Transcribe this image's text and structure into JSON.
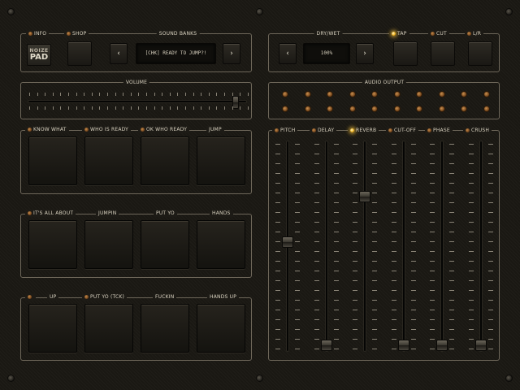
{
  "top": {
    "info_label": "INFO",
    "shop_label": "SHOP",
    "sound_banks_label": "SOUND BANKS",
    "logo_line1": "NOIZE",
    "logo_line2": "PAD",
    "prev_symbol": "‹",
    "next_symbol": "›",
    "bank_display": "[CHK] READY TO JUMP?!",
    "dry_wet_label": "DRY/WET",
    "dry_wet_value": "100%",
    "tap_label": "TAP",
    "cut_label": "CUT",
    "lr_label": "L/R"
  },
  "volume": {
    "label": "VOLUME",
    "level": 0.96
  },
  "audio_output": {
    "label": "AUDIO OUTPUT",
    "rows": 2,
    "per_row": 10
  },
  "pad_groups": [
    {
      "labels": [
        "KNOW WHAT",
        "WHO IS READY",
        "OK WHO READY",
        "JUMP"
      ]
    },
    {
      "labels": [
        "IT'S ALL ABOUT",
        "JUMPIN",
        "PUT YO",
        "HANDS"
      ]
    },
    {
      "labels": [
        "UP",
        "PUT YO (TCK)",
        "FUCKIN",
        "HANDS UP"
      ]
    }
  ],
  "effects": [
    {
      "label": "PITCH",
      "active": false,
      "level": 0.52
    },
    {
      "label": "DELAY",
      "active": false,
      "level": 0.0
    },
    {
      "label": "REVERB",
      "active": true,
      "level": 0.75
    },
    {
      "label": "CUT-OFF",
      "active": false,
      "level": 0.0
    },
    {
      "label": "PHASE",
      "active": false,
      "level": 0.0
    },
    {
      "label": "CRUSH",
      "active": false,
      "level": 0.0
    }
  ],
  "colors": {
    "led_on": "#f1b41e",
    "led_off": "#b5783e",
    "text": "#d9d2c0",
    "panel_border": "#6e675a"
  }
}
